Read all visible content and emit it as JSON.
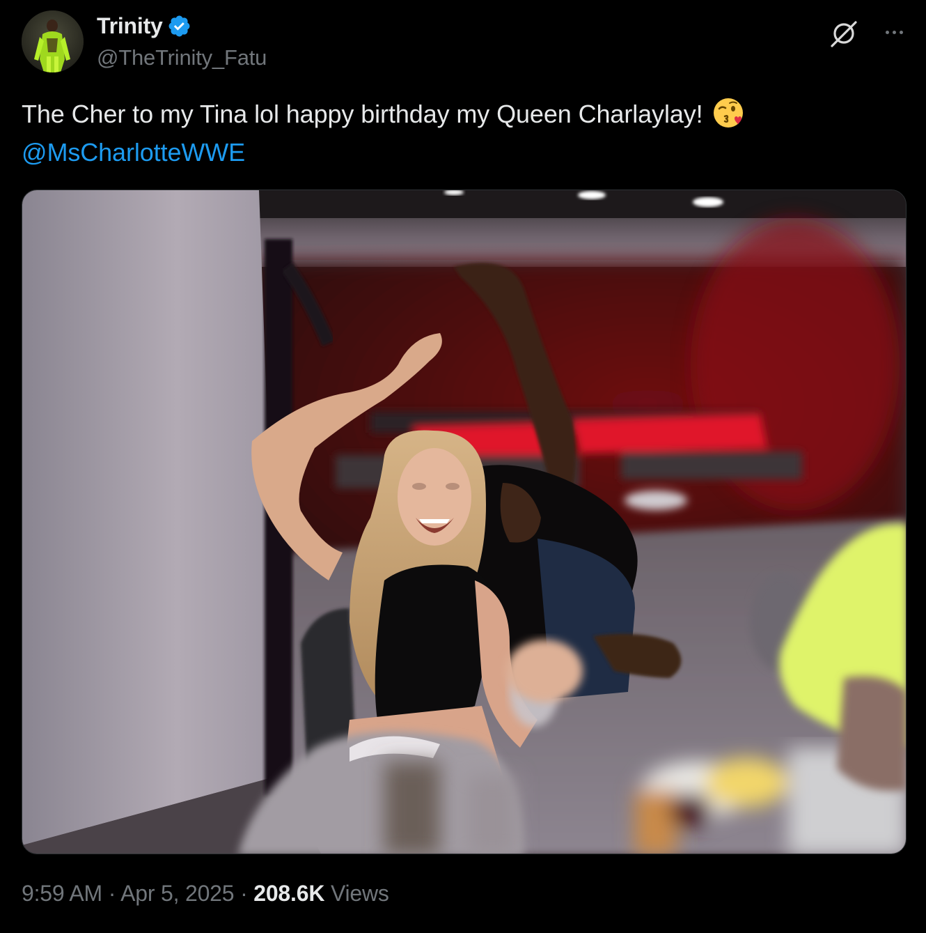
{
  "author": {
    "display_name": "Trinity",
    "handle": "@TheTrinity_Fatu",
    "verified": true,
    "avatar_icon": "avatar-photo"
  },
  "actions": {
    "grok_icon": "grok-icon",
    "more_icon": "more-horizontal-icon"
  },
  "tweet": {
    "text": "The Cher to my Tina lol happy birthday my Queen Charlaylay!",
    "emoji": "face-blowing-a-kiss-icon",
    "mention": "@MsCharlotteWWE"
  },
  "media": {
    "type": "photo",
    "icon": "photo-icon"
  },
  "footer": {
    "time": "9:59 AM",
    "separator": "·",
    "date": "Apr 5, 2025",
    "views_count": "208.6K",
    "views_label": "Views"
  },
  "colors": {
    "background": "#000000",
    "text_primary": "#e7e9ea",
    "text_secondary": "#71767b",
    "link": "#1d9bf0",
    "verified": "#1d9bf0"
  }
}
